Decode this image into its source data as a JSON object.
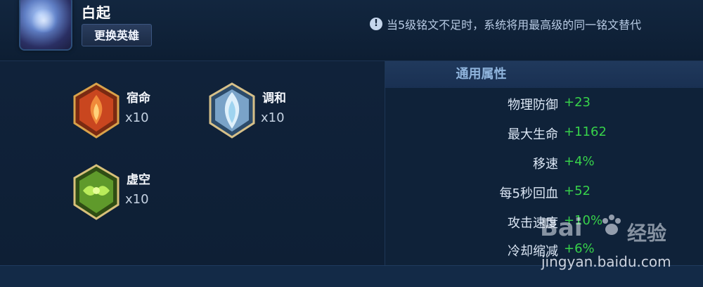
{
  "hero": {
    "name": "白起",
    "change_button": "更换英雄"
  },
  "notice": {
    "icon": "info-icon",
    "text": "当5级铭文不足时，系统将用最高级的同一铭文替代"
  },
  "runes": [
    {
      "name": "宿命",
      "count": "x10",
      "color": "#c9461f"
    },
    {
      "name": "调和",
      "count": "x10",
      "color": "#7aa3c8"
    },
    {
      "name": "虚空",
      "count": "x10",
      "color": "#5f9a2b"
    }
  ],
  "attributes": {
    "title": "通用属性",
    "rows": [
      {
        "name": "物理防御",
        "value": "+23"
      },
      {
        "name": "最大生命",
        "value": "+1162"
      },
      {
        "name": "移速",
        "value": "+4%"
      },
      {
        "name": "每5秒回血",
        "value": "+52"
      },
      {
        "name": "攻击速度",
        "value": "+10%"
      },
      {
        "name": "冷却缩减",
        "value": "+6%"
      }
    ]
  },
  "watermark": {
    "brand": "Bai",
    "suffix": "经验",
    "url": "jingyan.baidu.com"
  }
}
